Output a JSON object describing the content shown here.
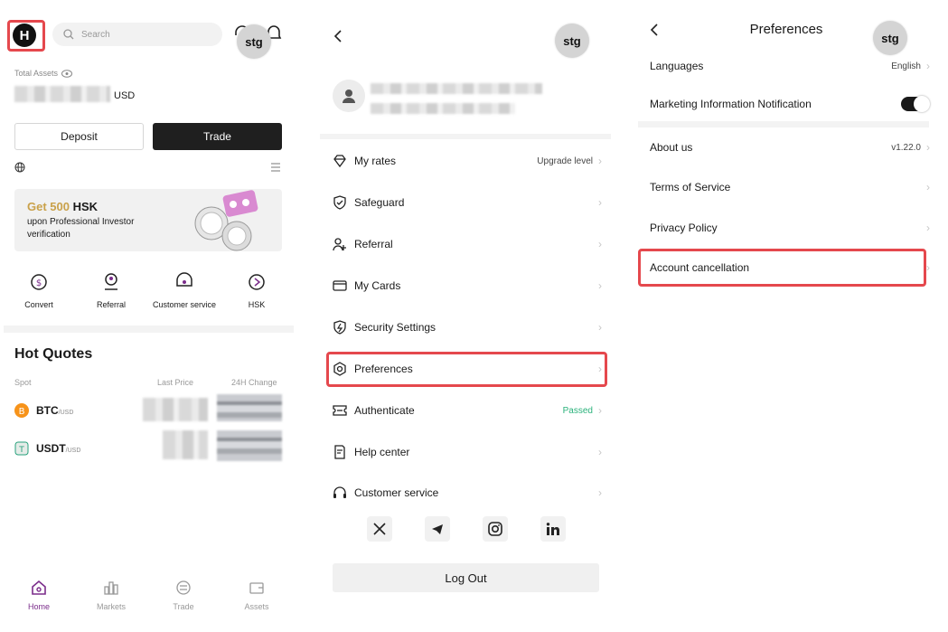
{
  "home": {
    "search_placeholder": "Search",
    "avatar_text": "stg",
    "total_assets_label": "Total Assets",
    "currency": "USD",
    "deposit_label": "Deposit",
    "trade_label": "Trade",
    "banner": {
      "headline_prefix": "Get 500",
      "headline_token": "HSK",
      "line2": "upon Professional Investor",
      "line3": "verification"
    },
    "quick_actions": [
      {
        "label": "Convert",
        "icon": "convert-icon"
      },
      {
        "label": "Referral",
        "icon": "referral-icon"
      },
      {
        "label": "Customer service",
        "icon": "customer-service-icon"
      },
      {
        "label": "HSK",
        "icon": "hsk-icon"
      }
    ],
    "hot_quotes_title": "Hot Quotes",
    "col_spot": "Spot",
    "col_last_price": "Last Price",
    "col_change": "24H Change",
    "quotes": [
      {
        "symbol": "BTC",
        "quote": "/USD",
        "color": "#f7931a"
      },
      {
        "symbol": "USDT",
        "quote": "/USD",
        "color": "#26a17b"
      }
    ],
    "nav": [
      {
        "label": "Home",
        "icon": "home-icon",
        "active": true
      },
      {
        "label": "Markets",
        "icon": "markets-icon",
        "active": false
      },
      {
        "label": "Trade",
        "icon": "trade-icon",
        "active": false
      },
      {
        "label": "Assets",
        "icon": "assets-icon",
        "active": false
      }
    ]
  },
  "account": {
    "avatar_text": "stg",
    "menu": [
      {
        "label": "My rates",
        "right": "Upgrade level",
        "icon": "diamond-icon"
      },
      {
        "label": "Safeguard",
        "right": "",
        "icon": "shield-check-icon"
      },
      {
        "label": "Referral",
        "right": "",
        "icon": "user-plus-icon"
      },
      {
        "label": "My Cards",
        "right": "",
        "icon": "card-icon"
      },
      {
        "label": "Security Settings",
        "right": "",
        "icon": "security-icon"
      },
      {
        "label": "Preferences",
        "right": "",
        "icon": "gear-hex-icon"
      },
      {
        "label": "Authenticate",
        "right": "Passed",
        "icon": "id-card-icon"
      },
      {
        "label": "Help center",
        "right": "",
        "icon": "help-doc-icon"
      },
      {
        "label": "Customer service",
        "right": "",
        "icon": "headset-icon"
      }
    ],
    "social": [
      "x-icon",
      "telegram-icon",
      "instagram-icon",
      "linkedin-icon"
    ],
    "logout_label": "Log Out",
    "passed_color": "#2ab27b"
  },
  "preferences": {
    "title": "Preferences",
    "avatar_text": "stg",
    "languages_label": "Languages",
    "languages_value": "English",
    "marketing_label": "Marketing Information Notification",
    "marketing_on": true,
    "about_label": "About us",
    "about_value": "v1.22.0",
    "terms_label": "Terms of Service",
    "privacy_label": "Privacy Policy",
    "cancel_label": "Account cancellation"
  },
  "accent_color": "#e5484d"
}
